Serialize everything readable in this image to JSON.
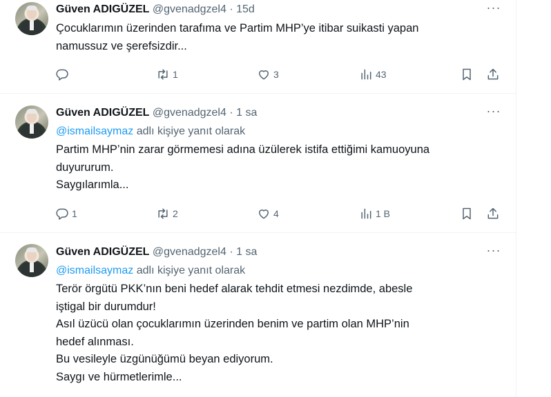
{
  "tweets": [
    {
      "author_name": "Güven ADIGÜZEL",
      "handle": "@gvenadgzel4",
      "separator": "·",
      "time": "15d",
      "reply_prefix": "",
      "reply_mention": "",
      "reply_suffix": "",
      "lines": [
        "Çocuklarımın üzerinden tarafıma ve Partim  MHP’ye itibar suikasti yapan",
        "namussuz ve şerefsizdir..."
      ],
      "replies": "",
      "retweets": "1",
      "likes": "3",
      "views": "43"
    },
    {
      "author_name": "Güven ADIGÜZEL",
      "handle": "@gvenadgzel4",
      "separator": "·",
      "time": "1 sa",
      "reply_prefix": "",
      "reply_mention": "@ismailsaymaz",
      "reply_suffix": " adlı kişiye yanıt olarak",
      "lines": [
        "Partim MHP’nin zarar görmemesi adına üzülerek istifa ettiğimi kamuoyuna",
        "duyururum.",
        "Saygılarımla..."
      ],
      "replies": "1",
      "retweets": "2",
      "likes": "4",
      "views": "1 B"
    },
    {
      "author_name": "Güven ADIGÜZEL",
      "handle": "@gvenadgzel4",
      "separator": "·",
      "time": "1 sa",
      "reply_prefix": "",
      "reply_mention": "@ismailsaymaz",
      "reply_suffix": " adlı kişiye yanıt olarak",
      "lines": [
        "Terör örgütü PKK’nın beni hedef alarak tehdit etmesi nezdimde, abesle",
        "iştigal bir durumdur!",
        "Asıl üzücü olan çocuklarımın üzerinden benim ve partim olan MHP’nin",
        "hedef alınması.",
        "Bu vesileyle üzgünüğümü beyan ediyorum.",
        "Saygı ve hürmetlerimle..."
      ]
    }
  ],
  "icons": {
    "more": "more-icon",
    "reply": "reply-icon",
    "retweet": "retweet-icon",
    "like": "like-icon",
    "views": "views-icon",
    "bookmark": "bookmark-icon",
    "share": "share-icon"
  },
  "colors": {
    "mention": "#1d9bf0",
    "secondary_text": "#536471",
    "primary_text": "#0f1419",
    "divider": "#eff3f4"
  }
}
